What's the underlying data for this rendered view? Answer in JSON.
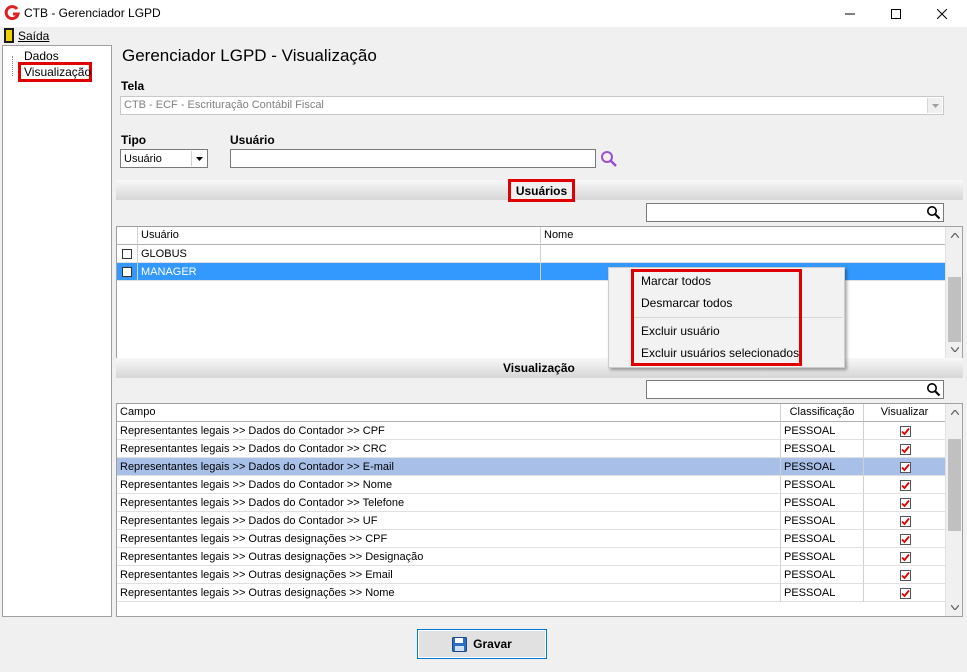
{
  "window": {
    "title": "CTB - Gerenciador LGPD"
  },
  "menu": {
    "exit_label": "Saída"
  },
  "tree": {
    "items": [
      "Dados",
      "Visualização"
    ]
  },
  "main": {
    "title": "Gerenciador LGPD - Visualização",
    "tela_label": "Tela",
    "tela_value": "CTB - ECF - Escrituração Contábil Fiscal",
    "tipo_label": "Tipo",
    "tipo_value": "Usuário",
    "usuario_label": "Usuário",
    "usuario_value": ""
  },
  "usuarios": {
    "title": "Usuários",
    "search_value": "",
    "columns": [
      "Usuário",
      "Nome"
    ],
    "rows": [
      {
        "usuario": "GLOBUS",
        "nome": "",
        "checked": false,
        "selected": false
      },
      {
        "usuario": "MANAGER",
        "nome": "",
        "checked": false,
        "selected": true
      }
    ]
  },
  "context_menu": {
    "items": [
      "Marcar todos",
      "Desmarcar todos",
      "Excluir usuário",
      "Excluir usuários selecionados"
    ]
  },
  "visualizacao": {
    "title": "Visualização",
    "search_value": "",
    "columns": [
      "Campo",
      "Classificação",
      "Visualizar"
    ],
    "rows": [
      {
        "campo": "Representantes legais >> Dados do Contador >> CPF",
        "classificacao": "PESSOAL",
        "visualizar": true
      },
      {
        "campo": "Representantes legais >> Dados do Contador >> CRC",
        "classificacao": "PESSOAL",
        "visualizar": true
      },
      {
        "campo": "Representantes legais >> Dados do Contador >> E-mail",
        "classificacao": "PESSOAL",
        "visualizar": true
      },
      {
        "campo": "Representantes legais >> Dados do Contador >> Nome",
        "classificacao": "PESSOAL",
        "visualizar": true
      },
      {
        "campo": "Representantes legais >> Dados do Contador >> Telefone",
        "classificacao": "PESSOAL",
        "visualizar": true
      },
      {
        "campo": "Representantes legais >> Dados do Contador >> UF",
        "classificacao": "PESSOAL",
        "visualizar": true
      },
      {
        "campo": "Representantes legais >> Outras designações >> CPF",
        "classificacao": "PESSOAL",
        "visualizar": true
      },
      {
        "campo": "Representantes legais >> Outras designações >> Designação",
        "classificacao": "PESSOAL",
        "visualizar": true
      },
      {
        "campo": "Representantes legais >> Outras designações >> Email",
        "classificacao": "PESSOAL",
        "visualizar": true
      },
      {
        "campo": "Representantes legais >> Outras designações >> Nome",
        "classificacao": "PESSOAL",
        "visualizar": true
      }
    ],
    "selected_row": 2
  },
  "buttons": {
    "save_label": "Gravar"
  },
  "colors": {
    "highlight": "#e00000",
    "selection": "#3399ff",
    "row_selection": "#a8c0e8",
    "check": "#e00000",
    "logo": "#e02020"
  }
}
